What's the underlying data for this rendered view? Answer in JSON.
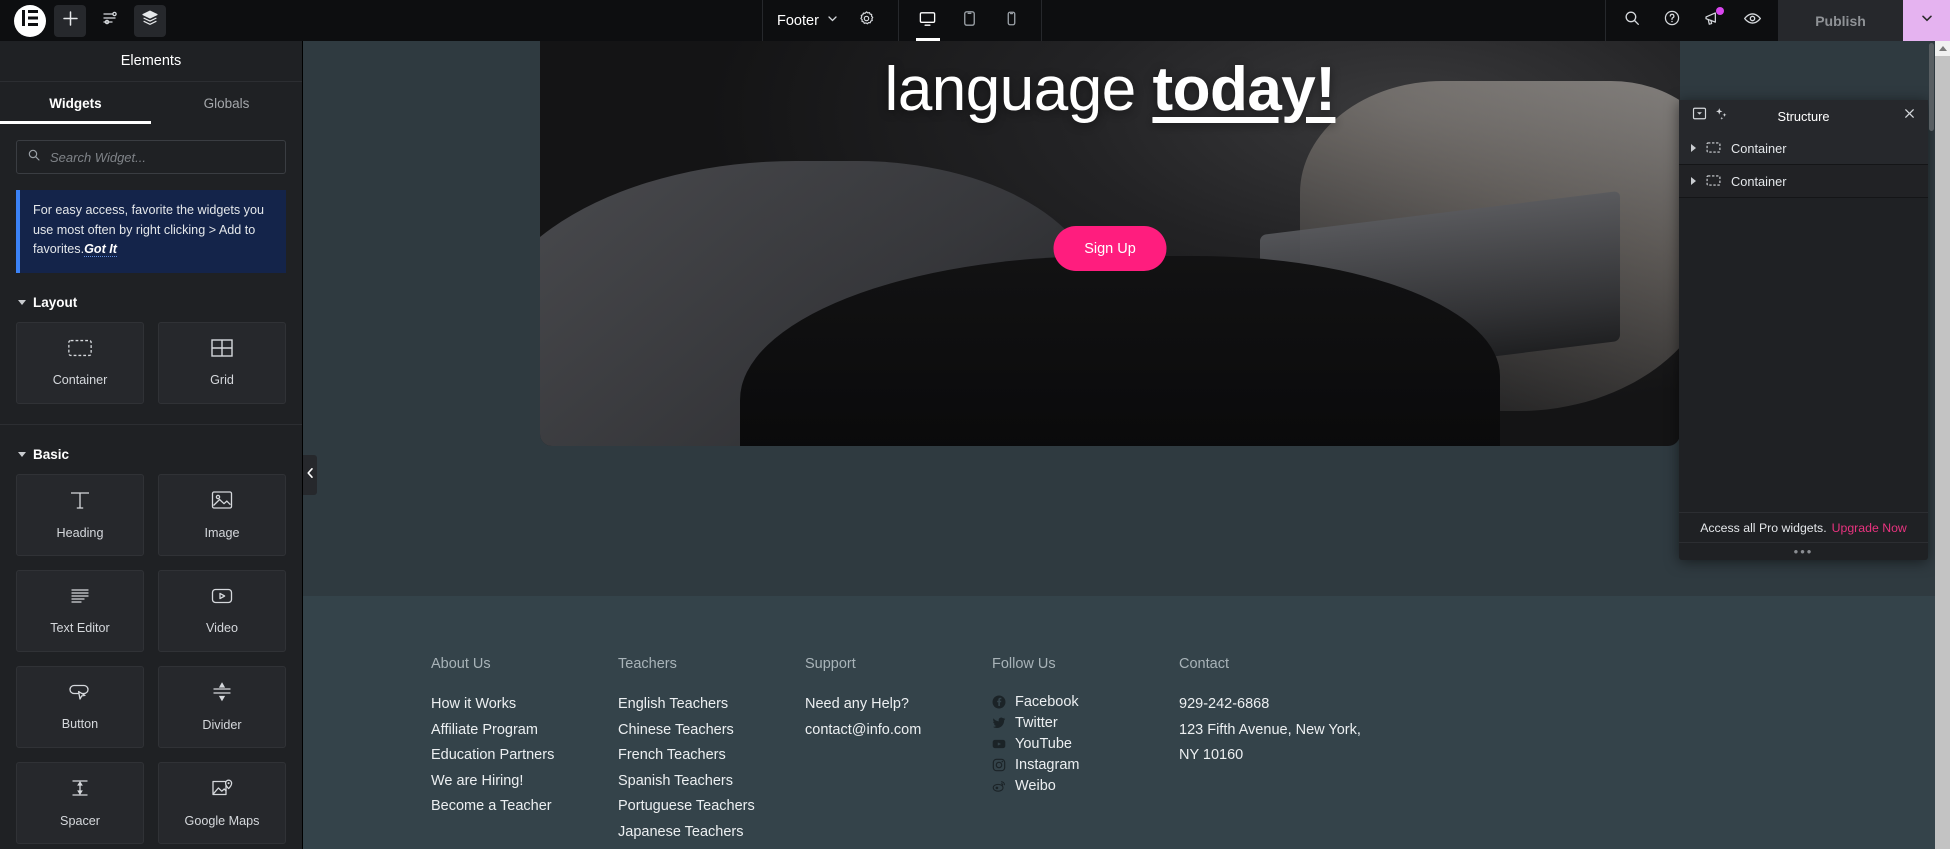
{
  "topbar": {
    "logo_icon": "elementor-logo-icon",
    "add_icon": "plus-icon",
    "settings_icon": "sliders-icon",
    "layers_icon": "layers-icon",
    "document_name": "Footer",
    "document_caret_icon": "chevron-down-icon",
    "document_settings_icon": "gear-icon",
    "devices": [
      {
        "name": "desktop",
        "icon": "desktop-icon",
        "active": true
      },
      {
        "name": "tablet",
        "icon": "tablet-icon",
        "active": false
      },
      {
        "name": "mobile",
        "icon": "mobile-icon",
        "active": false
      }
    ],
    "search_icon": "search-icon",
    "help_icon": "question-circle-icon",
    "whatsnew_icon": "megaphone-icon",
    "preview_icon": "eye-icon",
    "publish_label": "Publish",
    "publish_caret_icon": "chevron-down-icon",
    "accent_pink": "#e5b3f0",
    "notification_dot_color": "#d946ef"
  },
  "panel": {
    "title": "Elements",
    "tabs": [
      {
        "label": "Widgets",
        "active": true
      },
      {
        "label": "Globals",
        "active": false
      }
    ],
    "search": {
      "placeholder": "Search Widget...",
      "value": "",
      "icon": "search-icon"
    },
    "notice": {
      "text_before": "For easy access, favorite the widgets you use most often by right clicking > Add to favorites.",
      "action": "Got It",
      "accent": "#3b82f6"
    },
    "sections": [
      {
        "title": "Layout",
        "widgets": [
          {
            "label": "Container",
            "icon": "container-icon"
          },
          {
            "label": "Grid",
            "icon": "grid-icon"
          }
        ]
      },
      {
        "title": "Basic",
        "widgets": [
          {
            "label": "Heading",
            "icon": "heading-t-icon"
          },
          {
            "label": "Image",
            "icon": "image-icon"
          },
          {
            "label": "Text Editor",
            "icon": "text-editor-icon"
          },
          {
            "label": "Video",
            "icon": "video-play-icon"
          },
          {
            "label": "Button",
            "icon": "button-cursor-icon"
          },
          {
            "label": "Divider",
            "icon": "divider-icon"
          },
          {
            "label": "Spacer",
            "icon": "spacer-icon"
          },
          {
            "label": "Google Maps",
            "icon": "map-pin-image-icon"
          }
        ]
      }
    ],
    "collapse_icon": "chevron-left-icon"
  },
  "canvas": {
    "hero": {
      "heading_thin": "language",
      "heading_bold": "today!",
      "button_label": "Sign Up",
      "button_color": "#ff1d7e"
    },
    "footer": {
      "background": "#34434a",
      "columns": [
        {
          "title": "About Us",
          "links": [
            "How it Works",
            "Affiliate Program",
            "Education Partners",
            "We are Hiring!",
            "Become a Teacher"
          ]
        },
        {
          "title": "Teachers",
          "links": [
            "English Teachers",
            "Chinese Teachers",
            "French Teachers",
            "Spanish Teachers",
            "Portuguese Teachers",
            "Japanese Teachers"
          ]
        },
        {
          "title": "Support",
          "links": [
            "Need any Help?",
            "contact@info.com"
          ]
        },
        {
          "title": "Follow Us",
          "socials": [
            {
              "label": "Facebook",
              "icon": "facebook-icon"
            },
            {
              "label": "Twitter",
              "icon": "twitter-icon"
            },
            {
              "label": "YouTube",
              "icon": "youtube-icon"
            },
            {
              "label": "Instagram",
              "icon": "instagram-icon"
            },
            {
              "label": "Weibo",
              "icon": "weibo-icon"
            }
          ]
        },
        {
          "title": "Contact",
          "lines": [
            "929-242-6868",
            "123 Fifth Avenue, New York,",
            "NY 10160"
          ]
        }
      ]
    }
  },
  "structure": {
    "title": "Structure",
    "dock_icon": "dock-minimize-icon",
    "ai_icon": "sparkles-icon",
    "close_icon": "close-icon",
    "rows": [
      {
        "label": "Container",
        "icon": "container-icon",
        "expand_icon": "caret-right-icon"
      },
      {
        "label": "Container",
        "icon": "container-icon",
        "expand_icon": "caret-right-icon"
      }
    ],
    "promo_text": "Access all Pro widgets.",
    "promo_link": "Upgrade Now",
    "promo_link_color": "#e8337f",
    "grip": "•••"
  }
}
